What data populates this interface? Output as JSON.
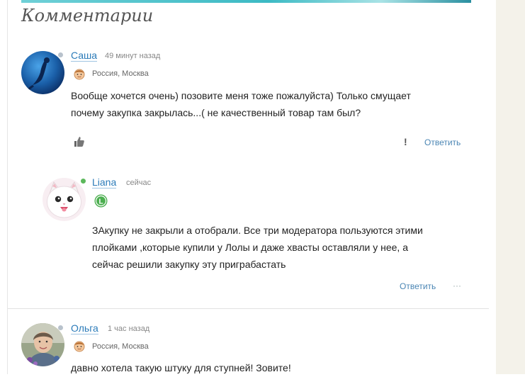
{
  "section": {
    "title": "Комментарии"
  },
  "comments": [
    {
      "author": "Саша",
      "time": "49 минут назад",
      "location": "Россия, Москва",
      "text": [
        "Вообще хочется очень) позовите меня тоже пожалуйста) Только смущает",
        "почему закупка закрылась...( не качественный товар там был?"
      ],
      "report": "!",
      "reply": "Ответить",
      "icons": {
        "avatar": "mermaid-avatar-icon",
        "badge": "user-face-icon",
        "like": "thumbs-up-icon"
      }
    },
    {
      "author": "Liana",
      "time": "сейчас",
      "badge_letter": "L",
      "text": [
        "ЗАкупку не закрыли а отобрали. Все три модератора пользуются этими",
        "плойками ,которые купили у Лолы и даже хвасты оставляли у нее, а",
        "сейчас решили закупку эту  приграбастать"
      ],
      "reply": "Ответить",
      "more": "···",
      "icons": {
        "avatar": "white-kitten-avatar-icon",
        "badge": "level-l-badge-icon"
      }
    },
    {
      "author": "Ольга",
      "time": "1 час назад",
      "location": "Россия, Москва",
      "text": [
        "давно хотела такую штуку для ступней! Зовите!"
      ],
      "icons": {
        "avatar": "woman-photo-avatar-icon",
        "badge": "user-face-icon"
      }
    }
  ],
  "colors": {
    "link": "#2b7bb9",
    "online": "#5cb85c",
    "offline": "#b8c2cc",
    "strip": "#f4f2ea"
  }
}
